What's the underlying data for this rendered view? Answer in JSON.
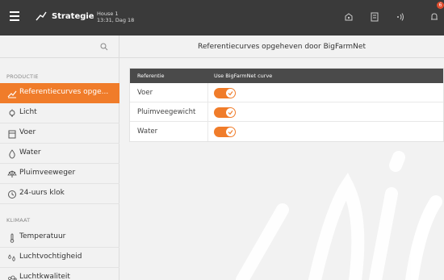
{
  "header": {
    "title": "Strategie",
    "house": "House 1",
    "datetime": "13:31, Dag 18",
    "notification_count": "6"
  },
  "sidebar": {
    "sections": [
      {
        "label": "PRODUCTIE"
      },
      {
        "label": "KLIMAAT"
      }
    ],
    "items": [
      {
        "label": "Referentiecurves opge...",
        "icon": "chart-line-icon",
        "active": true
      },
      {
        "label": "Licht",
        "icon": "light-bulb-icon"
      },
      {
        "label": "Voer",
        "icon": "feed-icon"
      },
      {
        "label": "Water",
        "icon": "water-drop-icon"
      },
      {
        "label": "Pluimveeweger",
        "icon": "scale-icon"
      },
      {
        "label": "24-uurs klok",
        "icon": "clock-icon"
      },
      {
        "label": "Temperatuur",
        "icon": "thermometer-icon"
      },
      {
        "label": "Luchtvochtigheid",
        "icon": "humidity-icon"
      },
      {
        "label": "Luchtkwaliteit",
        "icon": "air-quality-icon"
      }
    ]
  },
  "main": {
    "title": "Referentiecurves opgeheven door BigFarmNet",
    "table": {
      "headers": [
        "Referentie",
        "Use BigFarmNet curve"
      ],
      "rows": [
        {
          "label": "Voer",
          "enabled": true
        },
        {
          "label": "Pluimveegewicht",
          "enabled": true
        },
        {
          "label": "Water",
          "enabled": true
        }
      ]
    }
  },
  "colors": {
    "accent": "#f07c2a",
    "topbar": "#3a3a3a",
    "table_header": "#4a4a4a",
    "badge": "#e04e2f"
  }
}
